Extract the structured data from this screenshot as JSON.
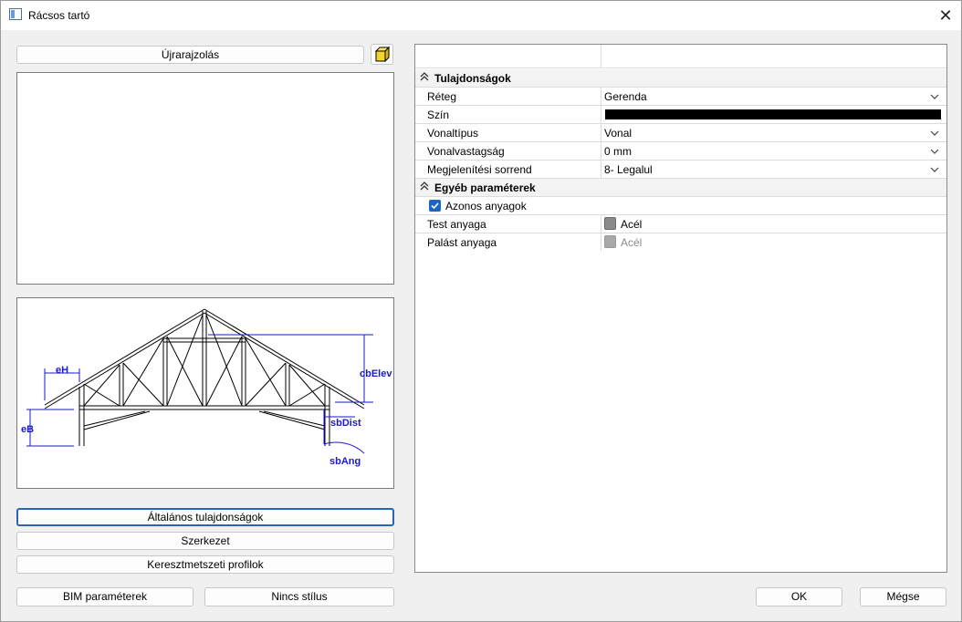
{
  "window": {
    "title": "Rácsos tartó"
  },
  "left": {
    "redraw_label": "Újrarajzolás",
    "cube_icon": "cube-icon",
    "diagram": {
      "eH": "eH",
      "eB": "eB",
      "cbElev": "cbElev",
      "sbDist": "sbDist",
      "sbAng": "sbAng"
    },
    "tabs": [
      {
        "label": "Általános tulajdonságok",
        "active": true
      },
      {
        "label": "Szerkezet",
        "active": false
      },
      {
        "label": "Keresztmetszeti profilok",
        "active": false
      }
    ],
    "bim_label": "BIM paraméterek",
    "style_label": "Nincs stílus"
  },
  "grid": {
    "sections": [
      {
        "title": "Tulajdonságok",
        "rows": [
          {
            "key": "Réteg",
            "value": "Gerenda"
          },
          {
            "key": "Szín",
            "value": ""
          },
          {
            "key": "Vonaltípus",
            "value": "Vonal"
          },
          {
            "key": "Vonalvastagság",
            "value": "0 mm"
          },
          {
            "key": "Megjelenítési sorrend",
            "value": "8- Legalul"
          }
        ]
      },
      {
        "title": "Egyéb paraméterek",
        "checkbox_label": "Azonos anyagok",
        "checkbox_checked": true,
        "rows": [
          {
            "key": "Test anyaga",
            "value": "Acél"
          },
          {
            "key": "Palást anyaga",
            "value": "Acél"
          }
        ]
      }
    ],
    "color_value": "#000000"
  },
  "footer": {
    "ok_label": "OK",
    "cancel_label": "Mégse"
  }
}
